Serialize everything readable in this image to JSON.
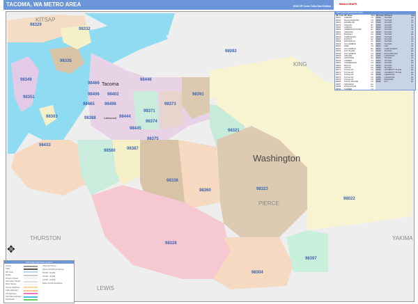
{
  "header": {
    "title": "TACOMA, WA METRO AREA",
    "edition": "2026 ZIP Code ColorCast Edition"
  },
  "logo": {
    "text": "Market MAPS"
  },
  "map": {
    "state_label": "Washington",
    "county_labels": [
      "KITSAP",
      "KING",
      "PIERCE",
      "THURSTON",
      "LEWIS",
      "YAKIMA"
    ],
    "city_labels": [
      "Tacoma",
      "Lakewood"
    ],
    "zip_labels": [
      "98329",
      "98332",
      "98335",
      "98349",
      "98351",
      "98303",
      "98092",
      "98391",
      "98402",
      "98406",
      "98466",
      "98465",
      "98498",
      "98371",
      "98374",
      "98375",
      "98321",
      "98433",
      "98580",
      "98387",
      "98338",
      "98360",
      "98323",
      "98022",
      "98328",
      "98304",
      "98397",
      "98444",
      "98445",
      "98373",
      "98388",
      "98446"
    ]
  },
  "zip_index": {
    "title": "ZIP Code Index/Grid Locator",
    "headers": [
      "ZIP Code",
      "ZIP Name",
      "Grid"
    ],
    "left": [
      [
        "98001",
        "AUBURN",
        "C4"
      ],
      [
        "98010",
        "BLACK DIAMOND",
        "C5"
      ],
      [
        "98022",
        "ENUMCLAW",
        "D5"
      ],
      [
        "98070",
        "VASHON",
        "B2"
      ],
      [
        "98092",
        "AUBURN",
        "B4"
      ],
      [
        "98303",
        "ANDERSON ISLAND",
        "E1"
      ],
      [
        "98304",
        "ASHFORD",
        "G4"
      ],
      [
        "98321",
        "BUCKLEY",
        "D4"
      ],
      [
        "98323",
        "CARBONADO",
        "E4"
      ],
      [
        "98327",
        "DUPONT",
        "E2"
      ],
      [
        "98328",
        "EATONVILLE",
        "F3"
      ],
      [
        "98329",
        "GIG HARBOR",
        "B1"
      ],
      [
        "98330",
        "ELBE",
        "G3"
      ],
      [
        "98332",
        "GIG HARBOR",
        "B2"
      ],
      [
        "98333",
        "FOX ISLAND",
        "D1"
      ],
      [
        "98335",
        "GIG HARBOR",
        "C2"
      ],
      [
        "98338",
        "GRAHAM",
        "E3"
      ],
      [
        "98344",
        "KAPOWSIN",
        "E3"
      ],
      [
        "98349",
        "LAKEBAY",
        "C1"
      ],
      [
        "98351",
        "LONGBRANCH",
        "D1"
      ],
      [
        "98354",
        "MILTON",
        "C3"
      ],
      [
        "98360",
        "ORTING",
        "E3"
      ],
      [
        "98371",
        "PUYALLUP",
        "C3"
      ],
      [
        "98372",
        "PUYALLUP",
        "C3"
      ],
      [
        "98373",
        "PUYALLUP",
        "D3"
      ],
      [
        "98374",
        "PUYALLUP",
        "D3"
      ],
      [
        "98375",
        "PUYALLUP",
        "D3"
      ],
      [
        "98385",
        "SOUTH PRAIRIE",
        "D4"
      ],
      [
        "98387",
        "SPANAWAY",
        "E2"
      ],
      [
        "98388",
        "STEILACOOM",
        "D2"
      ],
      [
        "98390",
        "SUMNER",
        "C4"
      ],
      [
        "98391",
        "BONNEY LAKE",
        "C4"
      ],
      [
        "98394",
        "VAUGHN",
        "B1"
      ],
      [
        "98396",
        "WILKESON",
        "E4"
      ],
      [
        "98397",
        "LONGMIRE",
        "G4"
      ]
    ],
    "right": [
      [
        "98402",
        "TACOMA",
        "C2"
      ],
      [
        "98403",
        "TACOMA",
        "C2"
      ],
      [
        "98404",
        "TACOMA",
        "C3"
      ],
      [
        "98405",
        "TACOMA",
        "C2"
      ],
      [
        "98406",
        "TACOMA",
        "C2"
      ],
      [
        "98407",
        "TACOMA",
        "C2"
      ],
      [
        "98408",
        "TACOMA",
        "C3"
      ],
      [
        "98409",
        "TACOMA",
        "D2"
      ],
      [
        "98416",
        "TACOMA",
        "C2"
      ],
      [
        "98418",
        "TACOMA",
        "C3"
      ],
      [
        "98421",
        "TACOMA",
        "C3"
      ],
      [
        "98422",
        "TACOMA",
        "C3"
      ],
      [
        "98424",
        "FIFE",
        "C3"
      ],
      [
        "98430",
        "CAMP MURRAY",
        "D2"
      ],
      [
        "98433",
        "TACOMA",
        "E2"
      ],
      [
        "98438",
        "MCCHORD AFB",
        "D2"
      ],
      [
        "98439",
        "LAKEWOOD",
        "D2"
      ],
      [
        "98443",
        "TACOMA",
        "C3"
      ],
      [
        "98444",
        "TACOMA",
        "D2"
      ],
      [
        "98445",
        "TACOMA",
        "D3"
      ],
      [
        "98446",
        "TACOMA",
        "D3"
      ],
      [
        "98465",
        "TACOMA",
        "C2"
      ],
      [
        "98466",
        "UNIVERSITY PLACE",
        "D2"
      ],
      [
        "98467",
        "UNIVERSITY PLACE",
        "D2"
      ],
      [
        "98498",
        "LAKEWOOD",
        "D2"
      ],
      [
        "98499",
        "LAKEWOOD",
        "D2"
      ],
      [
        "98558",
        "MCKENNA",
        "F3"
      ],
      [
        "98580",
        "ROY",
        "E2"
      ]
    ]
  },
  "legend": {
    "title": "ZIP Code ColorCast Legend",
    "items": [
      "County",
      "State",
      "ZIP Code",
      "Roads",
      "Primary Streets",
      "Secondary Streets",
      "Minor Streets",
      "County Highways",
      "State Highways",
      "US Highways",
      "Interstate Highways",
      "Rail Roads"
    ],
    "cities": [
      "Cities and Towns",
      "Above 100,000 and Above",
      "50,000 - 99,999",
      "25,000 - 49,999",
      "10,000 - 24,999",
      "Below 10,000 and Below"
    ]
  },
  "colors": {
    "header": "#6a95d8",
    "water": "#8fdcf2",
    "zip_label": "#3a63b0"
  }
}
